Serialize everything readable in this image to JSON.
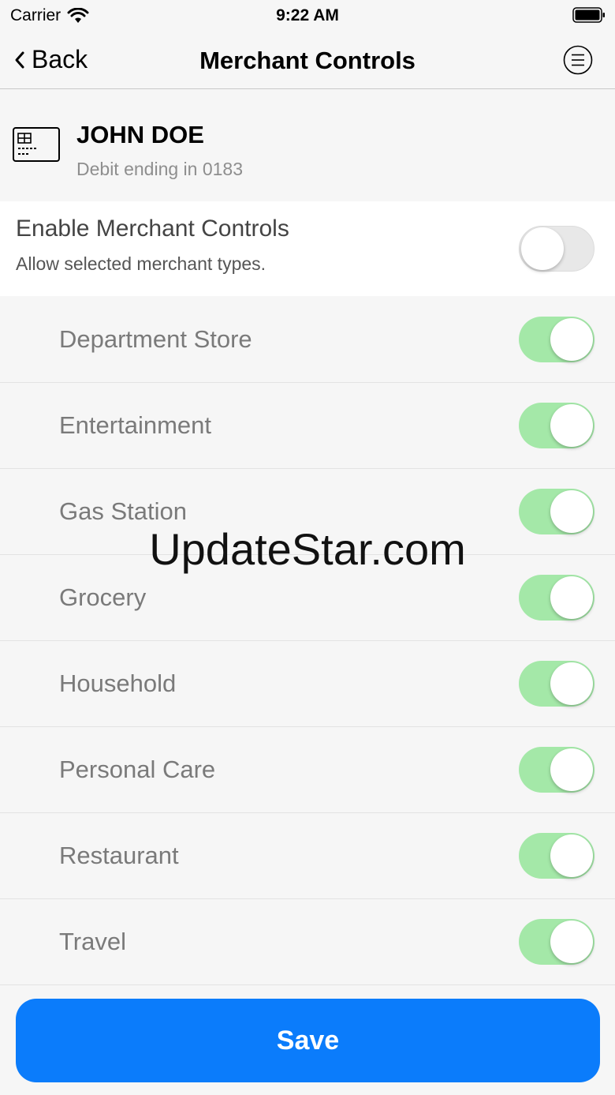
{
  "status_bar": {
    "carrier": "Carrier",
    "time": "9:22 AM"
  },
  "nav": {
    "back_label": "Back",
    "title": "Merchant Controls",
    "menu_icon": "menu-circle-icon"
  },
  "account": {
    "name": "JOHN DOE",
    "subtitle": "Debit ending in 0183",
    "icon": "card-icon"
  },
  "enable_controls": {
    "title": "Enable Merchant Controls",
    "subtitle": "Allow selected merchant types.",
    "enabled": false
  },
  "merchants": [
    {
      "label": "Department Store",
      "enabled": true
    },
    {
      "label": "Entertainment",
      "enabled": true
    },
    {
      "label": "Gas Station",
      "enabled": true
    },
    {
      "label": "Grocery",
      "enabled": true
    },
    {
      "label": "Household",
      "enabled": true
    },
    {
      "label": "Personal Care",
      "enabled": true
    },
    {
      "label": "Restaurant",
      "enabled": true
    },
    {
      "label": "Travel",
      "enabled": true
    }
  ],
  "watermark": "UpdateStar.com",
  "save_label": "Save",
  "colors": {
    "accent": "#0b7cfb",
    "toggle_on": "#a4e8a8",
    "toggle_off": "#e8e8e8"
  }
}
